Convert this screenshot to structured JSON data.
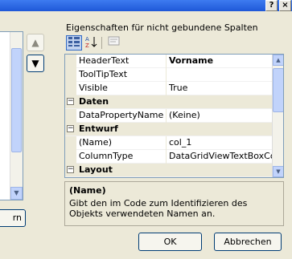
{
  "window": {
    "help_label": "?",
    "close_label": "×"
  },
  "left": {
    "remove_button_label": "rn"
  },
  "icons": {
    "move_up": "arrow-up-icon",
    "move_down": "arrow-down-icon",
    "categorized": "categorized-icon",
    "alphabetical": "alphabetical-sort-icon",
    "property_pages": "property-pages-icon"
  },
  "group_label": "Eigenschaften für nicht gebundene Spalten",
  "property_grid": {
    "rows": [
      {
        "type": "prop",
        "name": "HeaderText",
        "value": "Vorname",
        "value_bold": true
      },
      {
        "type": "prop",
        "name": "ToolTipText",
        "value": ""
      },
      {
        "type": "prop",
        "name": "Visible",
        "value": "True"
      },
      {
        "type": "category",
        "name": "Daten",
        "expander": "−"
      },
      {
        "type": "prop",
        "name": "DataPropertyName",
        "value": "(Keine)"
      },
      {
        "type": "category",
        "name": "Entwurf",
        "expander": "−"
      },
      {
        "type": "prop",
        "name": "(Name)",
        "value": "col_1"
      },
      {
        "type": "prop",
        "name": "ColumnType",
        "value": "DataGridViewTextBoxColu"
      },
      {
        "type": "category",
        "name": "Layout",
        "expander": "−"
      }
    ]
  },
  "description": {
    "title": "(Name)",
    "text": "Gibt den im Code zum Identifizieren des Objekts verwendeten Namen an."
  },
  "buttons": {
    "ok": "OK",
    "cancel": "Abbrechen"
  },
  "colors": {
    "dialog_bg": "#ece9d8",
    "selection": "#316ac5",
    "border": "#7f9db9"
  }
}
